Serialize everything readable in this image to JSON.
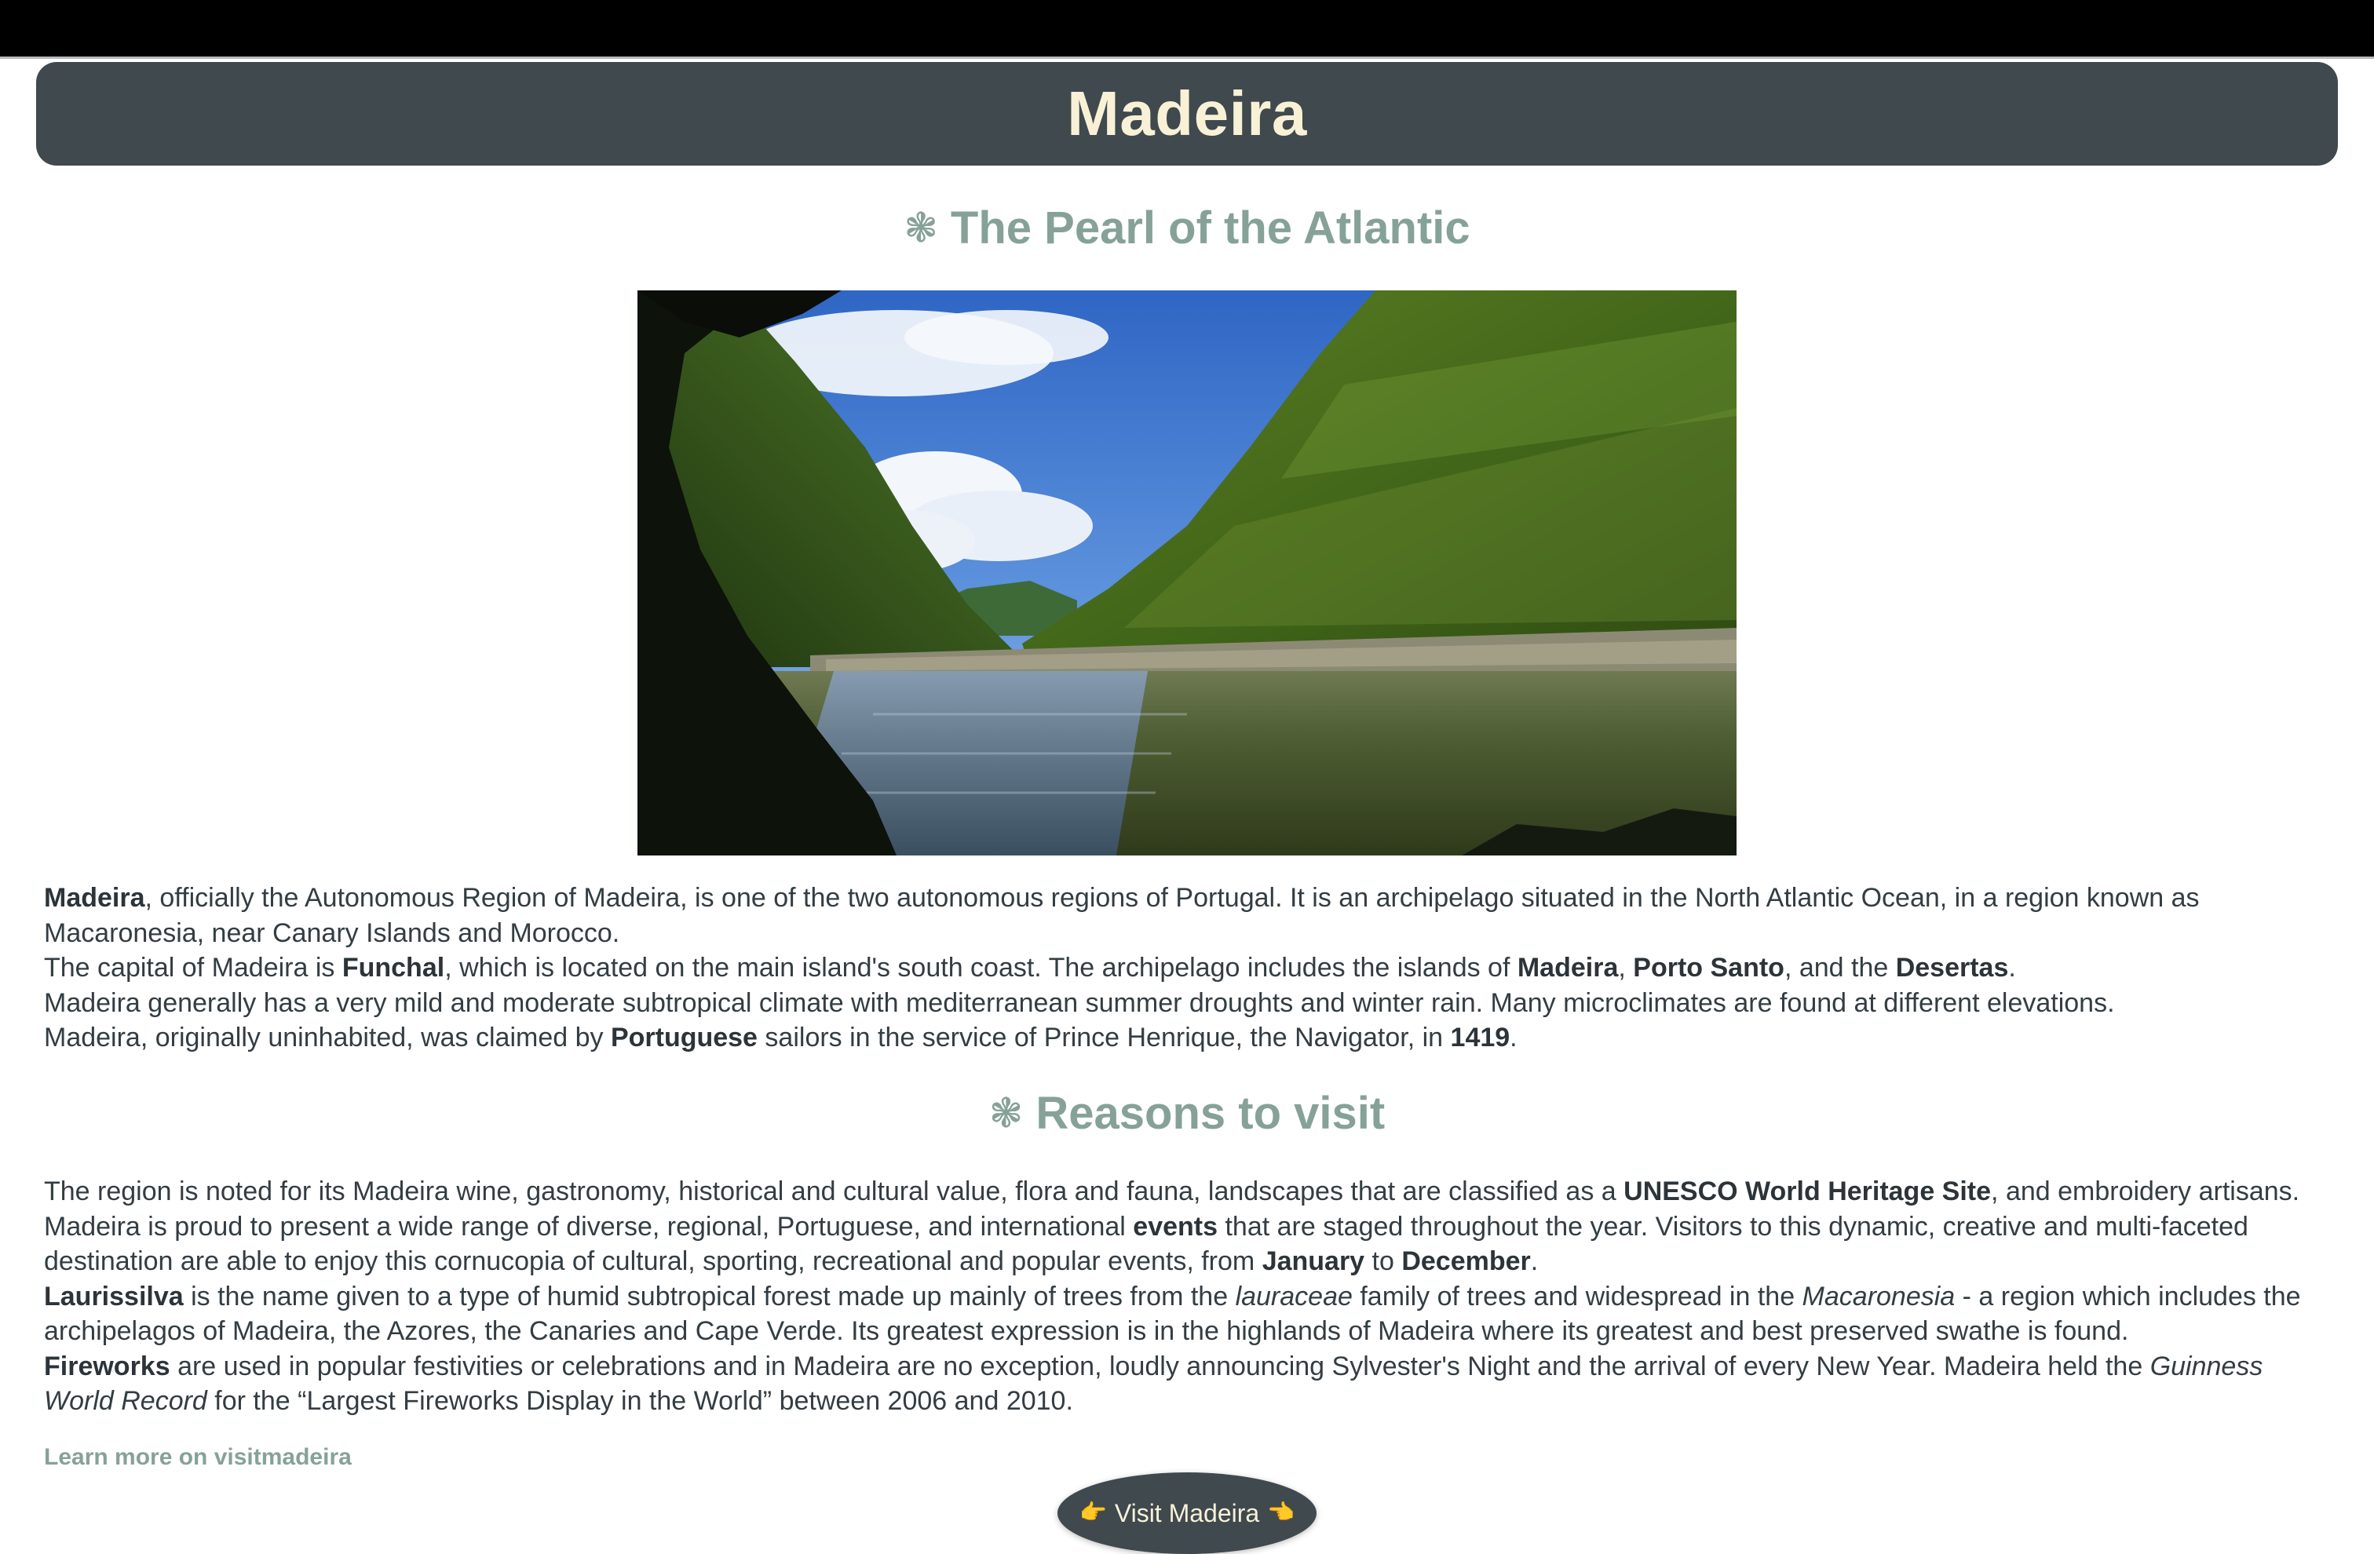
{
  "header": {
    "title": "Madeira"
  },
  "section1": {
    "icon": "flower-icon",
    "icon_glyph": "❃",
    "heading": "The Pearl of the Atlantic"
  },
  "hero_image": {
    "alt": "Madeira lagoon in a green valley"
  },
  "intro": {
    "p1_b1": "Madeira",
    "p1_t1": ", officially the Autonomous Region of Madeira, is one of the two autonomous regions of Portugal. It is an archipelago situated in the North Atlantic Ocean, in a region known as Macaronesia, near Canary Islands and Morocco.",
    "p2_t1": "The capital of Madeira is ",
    "p2_b1": "Funchal",
    "p2_t2": ", which is located on the main island's south coast. The archipelago includes the islands of ",
    "p2_b2": "Madeira",
    "p2_t3": ", ",
    "p2_b3": "Porto Santo",
    "p2_t4": ", and the ",
    "p2_b4": "Desertas",
    "p2_t5": ".",
    "p3": "Madeira generally has a very mild and moderate subtropical climate with mediterranean summer droughts and winter rain. Many microclimates are found at different elevations.",
    "p4_t1": "Madeira, originally uninhabited, was claimed by ",
    "p4_b1": "Portuguese",
    "p4_t2": " sailors in the service of Prince Henrique, the Navigator, in ",
    "p4_b2": "1419",
    "p4_t3": "."
  },
  "section2": {
    "icon": "flower-icon",
    "icon_glyph": "❃",
    "heading": "Reasons to visit"
  },
  "reasons": {
    "p1_t1": "The region is noted for its Madeira wine, gastronomy, historical and cultural value, flora and fauna, landscapes that are classified as a ",
    "p1_b1": "UNESCO World Heritage Site",
    "p1_t2": ", and embroidery artisans.",
    "p2_t1": "Madeira is proud to present a wide range of diverse, regional, Portuguese, and international ",
    "p2_b1": "events",
    "p2_t2": " that are staged throughout the year. Visitors to this dynamic, creative and multi-faceted destination are able to enjoy this cornucopia of cultural, sporting, recreational and popular events, from ",
    "p2_b2": "January",
    "p2_t3": " to ",
    "p2_b3": "December",
    "p2_t4": ".",
    "p3_b1": "Laurissilva",
    "p3_t1": " is the name given to a type of humid subtropical forest made up mainly of trees from the ",
    "p3_i1": "lauraceae",
    "p3_t2": " family of trees and widespread in the ",
    "p3_i2": "Macaronesia",
    "p3_t3": " - a region which includes the archipelagos of Madeira, the Azores, the Canaries and Cape Verde. Its greatest expression is in the highlands of Madeira where its greatest and best preserved swathe is found.",
    "p4_b1": "Fireworks",
    "p4_t1": " are used in popular festivities or celebrations and in Madeira are no exception, loudly announcing Sylvester's Night and the arrival of every New Year. Madeira held the ",
    "p4_i1": "Guinness World Record",
    "p4_t2": " for the “Largest Fireworks Display in the World” between 2006 and 2010."
  },
  "links": {
    "learn_more": "Learn more on visitmadeira"
  },
  "visit_button": {
    "left_icon": "pointing-right-hand-icon",
    "left_glyph": "👉",
    "label": "Visit Madeira",
    "right_icon": "pointing-left-hand-icon",
    "right_glyph": "👈"
  },
  "colors": {
    "header_bg": "#3f494e",
    "header_text": "#f8f1d6",
    "accent_green": "#86a298",
    "body_text": "#333d42"
  }
}
